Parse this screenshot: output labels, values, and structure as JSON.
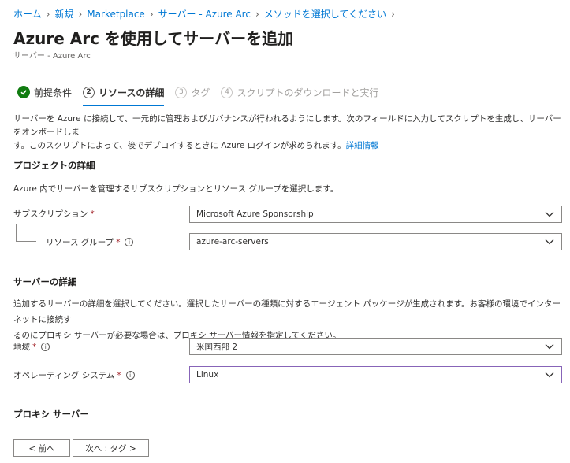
{
  "breadcrumb": {
    "items": [
      "ホーム",
      "新規",
      "Marketplace",
      "サーバー - Azure Arc",
      "メソッドを選択してください"
    ]
  },
  "page": {
    "title": "Azure Arc を使用してサーバーを追加",
    "subtitle": "サーバー - Azure Arc"
  },
  "tabs": [
    {
      "label": "前提条件",
      "state": "completed"
    },
    {
      "number": "2",
      "label": "リソースの詳細",
      "state": "active"
    },
    {
      "number": "3",
      "label": "タグ",
      "state": "disabled"
    },
    {
      "number": "4",
      "label": "スクリプトのダウンロードと実行",
      "state": "disabled"
    }
  ],
  "intro": {
    "line1": "サーバーを Azure に接続して、一元的に管理およびガバナンスが行われるようにします。次のフィールドに入力してスクリプトを生成し、サーバーをオンボードしま",
    "line2": "す。このスクリプトによって、後でデプロイするときに Azure ログインが求められます。",
    "link": "詳細情報"
  },
  "project": {
    "title": "プロジェクトの詳細",
    "description": "Azure 内でサーバーを管理するサブスクリプションとリソース グループを選択します。",
    "subscription_label": "サブスクリプション",
    "subscription_value": "Microsoft Azure Sponsorship",
    "resource_group_label": "リソース グループ",
    "resource_group_value": "azure-arc-servers"
  },
  "server": {
    "title": "サーバーの詳細",
    "description_line1": "追加するサーバーの詳細を選択してください。選択したサーバーの種類に対するエージェント パッケージが生成されます。お客様の環境でインターネットに接続す",
    "description_line2": "るのにプロキシ サーバーが必要な場合は、プロキシ サーバー情報を指定してください。",
    "region_label": "地域",
    "region_value": "米国西部 2",
    "os_label": "オペレーティング システム",
    "os_value": "Linux"
  },
  "proxy": {
    "title": "プロキシ サーバー"
  },
  "required_mark": "*",
  "info_glyph": "i",
  "footer": {
    "prev_label": "< 前へ",
    "next_label": "次へ : タグ >"
  },
  "colors": {
    "link": "#0078d4",
    "success": "#107c10",
    "required": "#a4262c",
    "focus": "#8764b8"
  }
}
